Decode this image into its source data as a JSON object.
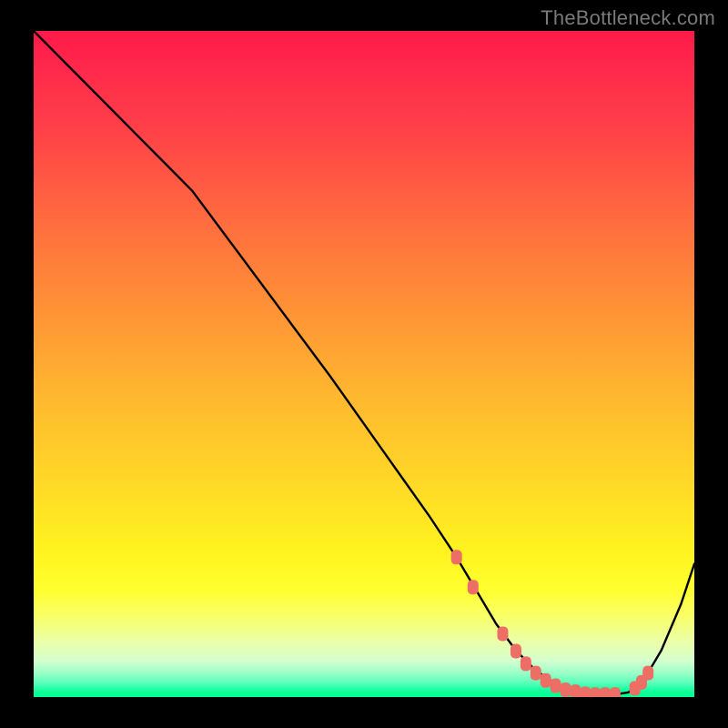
{
  "watermark": "TheBottleneck.com",
  "chart_data": {
    "type": "line",
    "title": "",
    "xlabel": "",
    "ylabel": "",
    "xlim": [
      0,
      100
    ],
    "ylim": [
      0,
      100
    ],
    "grid": false,
    "series": [
      {
        "name": "bottleneck-curve",
        "color": "#000000",
        "x": [
          0,
          5,
          10,
          15,
          20,
          24,
          45,
          55,
          60,
          64,
          67,
          70,
          73,
          76,
          79,
          82,
          85,
          88,
          90,
          92,
          95,
          98,
          100
        ],
        "y": [
          100,
          95,
          90,
          85,
          80,
          76,
          48,
          34,
          27,
          21,
          16,
          11,
          7,
          4,
          2,
          0.8,
          0.4,
          0.4,
          0.7,
          2,
          7,
          14,
          20
        ]
      }
    ],
    "markers": {
      "name": "highlight-points",
      "color": "#ec6e64",
      "shape": "rounded-rect",
      "points": [
        {
          "x": 64,
          "y": 21
        },
        {
          "x": 66.5,
          "y": 16.5
        },
        {
          "x": 71,
          "y": 9.5
        },
        {
          "x": 73,
          "y": 6.9
        },
        {
          "x": 74.5,
          "y": 5.0
        },
        {
          "x": 76,
          "y": 3.6
        },
        {
          "x": 77.5,
          "y": 2.5
        },
        {
          "x": 79,
          "y": 1.7
        },
        {
          "x": 80.5,
          "y": 1.1
        },
        {
          "x": 82,
          "y": 0.8
        },
        {
          "x": 83.5,
          "y": 0.5
        },
        {
          "x": 85,
          "y": 0.4
        },
        {
          "x": 86.5,
          "y": 0.4
        },
        {
          "x": 88,
          "y": 0.4
        },
        {
          "x": 91,
          "y": 1.3
        },
        {
          "x": 92,
          "y": 2.2
        },
        {
          "x": 93,
          "y": 3.6
        }
      ]
    },
    "background_gradient": {
      "direction": "vertical",
      "stops": [
        {
          "pos": 0.0,
          "color": "#ff1a4a"
        },
        {
          "pos": 0.3,
          "color": "#ff7a3a"
        },
        {
          "pos": 0.6,
          "color": "#ffd028"
        },
        {
          "pos": 0.82,
          "color": "#ffff2a"
        },
        {
          "pos": 0.94,
          "color": "#d8ffcb"
        },
        {
          "pos": 1.0,
          "color": "#00ff8f"
        }
      ]
    }
  }
}
